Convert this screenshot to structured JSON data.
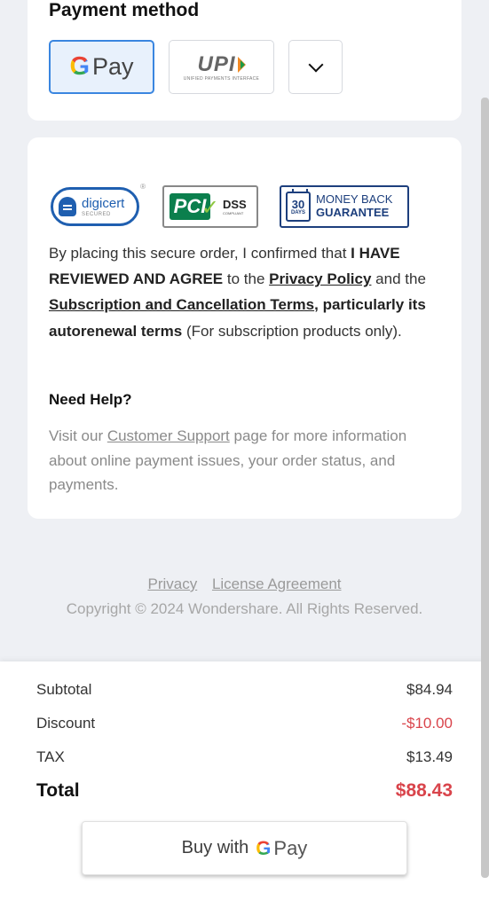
{
  "payment": {
    "title": "Payment method",
    "gpay_g": "G",
    "gpay_text": "Pay",
    "upi_text": "UPI",
    "upi_sub": "UNIFIED PAYMENTS INTERFACE"
  },
  "badges": {
    "digicert_name": "digicert",
    "digicert_reg": "®",
    "digicert_secured": "SECURED",
    "pci_logo": "PCI",
    "pci_dss": "DSS",
    "pci_compliant": "COMPLIANT",
    "money_days_num": "30",
    "money_days": "DAYS",
    "money_line1": "MONEY BACK",
    "money_line2": "GUARANTEE"
  },
  "terms": {
    "t1": "By placing this secure order, I confirmed that ",
    "t2": "I HAVE REVIEWED AND AGREE",
    "t3": " to the ",
    "privacy_link": "Privacy Policy",
    "t4": " and the ",
    "subscription_link": "Subscription and Cancellation Terms",
    "t5": ", particularly its autorenewal terms",
    "t6": " (For subscription products only)."
  },
  "help": {
    "title": "Need Help?",
    "h1": "Visit our ",
    "support_link": "Customer Support",
    "h2": " page for more information about online payment issues, your order status, and payments."
  },
  "footer": {
    "privacy": "Privacy",
    "license": "License Agreement",
    "copyright": "Copyright © 2024 Wondershare. All Rights Reserved."
  },
  "summary": {
    "subtotal_label": "Subtotal",
    "subtotal_value": "$84.94",
    "discount_label": "Discount",
    "discount_value": "-$10.00",
    "tax_label": "TAX",
    "tax_value": "$13.49",
    "total_label": "Total",
    "total_value": "$88.43",
    "buy_prefix": "Buy with",
    "buy_g": "G",
    "buy_pay": "Pay"
  },
  "colors": {
    "accent_blue": "#3a86e0",
    "price_red": "#d9444b"
  }
}
